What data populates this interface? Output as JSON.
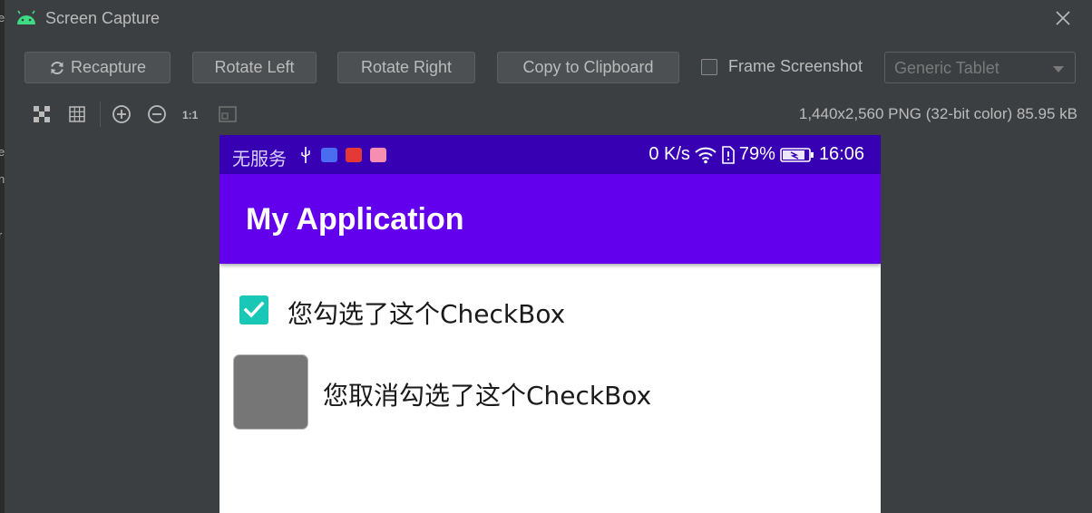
{
  "window": {
    "title": "Screen Capture"
  },
  "toolbar": {
    "recapture": "Recapture",
    "rotate_left": "Rotate Left",
    "rotate_right": "Rotate Right",
    "copy_clipboard": "Copy to Clipboard",
    "frame_screenshot": "Frame Screenshot",
    "frame_screenshot_checked": false,
    "device_select": "Generic Tablet"
  },
  "image_info": "1,440x2,560 PNG (32-bit color) 85.95 kB",
  "edge_letters": [
    "e",
    "e",
    "n",
    "r"
  ],
  "phone": {
    "status": {
      "carrier": "无服务",
      "speed": "0 K/s",
      "battery": "79%",
      "time": "16:06"
    },
    "app_title": "My Application",
    "checkbox1": {
      "label": "您勾选了这个CheckBox",
      "checked": true
    },
    "checkbox2": {
      "label": "您取消勾选了这个CheckBox",
      "checked": false
    }
  },
  "colors": {
    "android_green": "#3ddc84",
    "status_bar": "#3700b3",
    "app_bar": "#6200ee",
    "checkbox_accent": "#18c7b6",
    "unchecked_box": "#767676"
  }
}
